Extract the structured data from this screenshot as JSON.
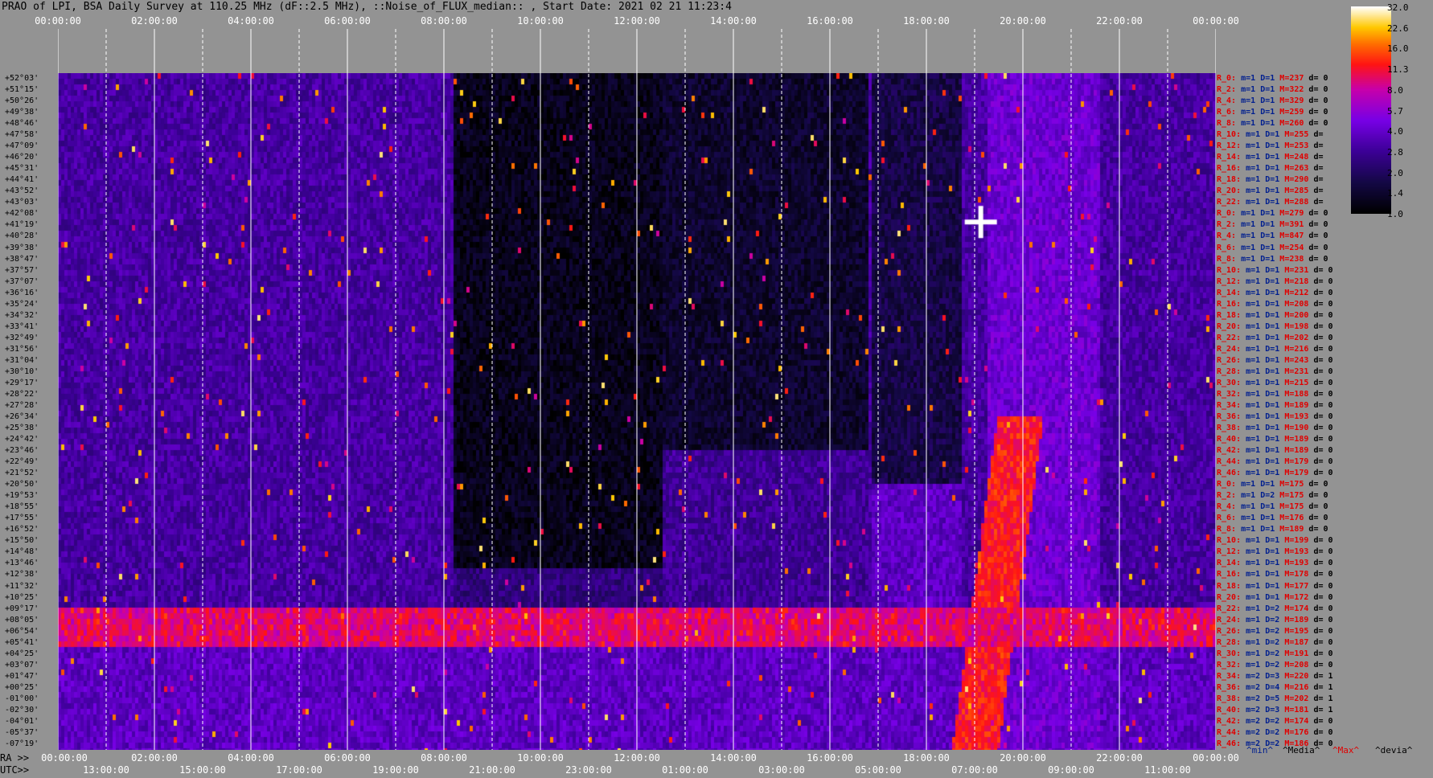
{
  "title": "PRAO of LPI, BSA Daily Survey at 110.25 MHz (dF::2.5 MHz), ::Noise_of_FLUX_median:: , Start Date: 2021 02 21 11:23:4",
  "chart_data": {
    "type": "heatmap",
    "title": "PRAO of LPI, BSA Daily Survey at 110.25 MHz (dF::2.5 MHz), ::Noise_of_FLUX_median:: , Start Date: 2021 02 21 11:23:4",
    "x_top_labels": [
      "00:00:00",
      "02:00:00",
      "04:00:00",
      "06:00:00",
      "08:00:00",
      "10:00:00",
      "12:00:00",
      "14:00:00",
      "16:00:00",
      "18:00:00",
      "20:00:00",
      "22:00:00",
      "00:00:00"
    ],
    "x_ra_labels": [
      "00:00:00",
      "02:00:00",
      "04:00:00",
      "06:00:00",
      "08:00:00",
      "10:00:00",
      "12:00:00",
      "14:00:00",
      "16:00:00",
      "18:00:00",
      "20:00:00",
      "22:00:00",
      "00:00:00"
    ],
    "x_utc_labels": [
      "13:00:00",
      "15:00:00",
      "17:00:00",
      "19:00:00",
      "21:00:00",
      "23:00:00",
      "01:00:00",
      "03:00:00",
      "05:00:00",
      "07:00:00",
      "09:00:00",
      "11:00:00"
    ],
    "ra_prefix": "RA >>",
    "utc_prefix": "UTC>>",
    "declinations": [
      "+52°03'",
      "+51°15'",
      "+50°26'",
      "+49°38'",
      "+48°46'",
      "+47°58'",
      "+47°09'",
      "+46°20'",
      "+45°31'",
      "+44°41'",
      "+43°52'",
      "+43°03'",
      "+42°08'",
      "+41°19'",
      "+40°28'",
      "+39°38'",
      "+38°47'",
      "+37°57'",
      "+37°07'",
      "+36°16'",
      "+35°24'",
      "+34°32'",
      "+33°41'",
      "+32°49'",
      "+31°56'",
      "+31°04'",
      "+30°10'",
      "+29°17'",
      "+28°22'",
      "+27°28'",
      "+26°34'",
      "+25°38'",
      "+24°42'",
      "+23°46'",
      "+22°49'",
      "+21°52'",
      "+20°50'",
      "+19°53'",
      "+18°55'",
      "+17°55'",
      "+16°52'",
      "+15°50'",
      "+14°48'",
      "+13°46'",
      "+12°38'",
      "+11°32'",
      "+10°25'",
      "+09°17'",
      "+08°05'",
      "+06°54'",
      "+05°41'",
      "+04°25'",
      "+03°07'",
      "+01°47'",
      "+00°25'",
      "-01°00'",
      "-02°30'",
      "-04°01'",
      "-05°37'",
      "-07°19'"
    ],
    "row_labels": [
      [
        "R_0:",
        "m=1",
        "D=1",
        "M=237",
        "d= 0"
      ],
      [
        "R_2:",
        "m=1",
        "D=1",
        "M=322",
        "d= 0"
      ],
      [
        "R_4:",
        "m=1",
        "D=1",
        "M=329",
        "d= 0"
      ],
      [
        "R_6:",
        "m=1",
        "D=1",
        "M=259",
        "d= 0"
      ],
      [
        "R_8:",
        "m=1",
        "D=1",
        "M=260",
        "d= 0"
      ],
      [
        "R_10:",
        "m=1",
        "D=1",
        "M=255",
        "d="
      ],
      [
        "R_12:",
        "m=1",
        "D=1",
        "M=253",
        "d="
      ],
      [
        "R_14:",
        "m=1",
        "D=1",
        "M=248",
        "d="
      ],
      [
        "R_16:",
        "m=1",
        "D=1",
        "M=263",
        "d="
      ],
      [
        "R_18:",
        "m=1",
        "D=1",
        "M=290",
        "d="
      ],
      [
        "R_20:",
        "m=1",
        "D=1",
        "M=285",
        "d="
      ],
      [
        "R_22:",
        "m=1",
        "D=1",
        "M=288",
        "d="
      ],
      [
        "R_0:",
        "m=1",
        "D=1",
        "M=279",
        "d= 0"
      ],
      [
        "R_2:",
        "m=1",
        "D=1",
        "M=391",
        "d= 0"
      ],
      [
        "R_4:",
        "m=1",
        "D=1",
        "M=847",
        "d= 0"
      ],
      [
        "R_6:",
        "m=1",
        "D=1",
        "M=254",
        "d= 0"
      ],
      [
        "R_8:",
        "m=1",
        "D=1",
        "M=238",
        "d= 0"
      ],
      [
        "R_10:",
        "m=1",
        "D=1",
        "M=231",
        "d= 0"
      ],
      [
        "R_12:",
        "m=1",
        "D=1",
        "M=218",
        "d= 0"
      ],
      [
        "R_14:",
        "m=1",
        "D=1",
        "M=212",
        "d= 0"
      ],
      [
        "R_16:",
        "m=1",
        "D=1",
        "M=208",
        "d= 0"
      ],
      [
        "R_18:",
        "m=1",
        "D=1",
        "M=200",
        "d= 0"
      ],
      [
        "R_20:",
        "m=1",
        "D=1",
        "M=198",
        "d= 0"
      ],
      [
        "R_22:",
        "m=1",
        "D=1",
        "M=202",
        "d= 0"
      ],
      [
        "R_24:",
        "m=1",
        "D=1",
        "M=216",
        "d= 0"
      ],
      [
        "R_26:",
        "m=1",
        "D=1",
        "M=243",
        "d= 0"
      ],
      [
        "R_28:",
        "m=1",
        "D=1",
        "M=231",
        "d= 0"
      ],
      [
        "R_30:",
        "m=1",
        "D=1",
        "M=215",
        "d= 0"
      ],
      [
        "R_32:",
        "m=1",
        "D=1",
        "M=188",
        "d= 0"
      ],
      [
        "R_34:",
        "m=1",
        "D=1",
        "M=189",
        "d= 0"
      ],
      [
        "R_36:",
        "m=1",
        "D=1",
        "M=193",
        "d= 0"
      ],
      [
        "R_38:",
        "m=1",
        "D=1",
        "M=190",
        "d= 0"
      ],
      [
        "R_40:",
        "m=1",
        "D=1",
        "M=189",
        "d= 0"
      ],
      [
        "R_42:",
        "m=1",
        "D=1",
        "M=189",
        "d= 0"
      ],
      [
        "R_44:",
        "m=1",
        "D=1",
        "M=179",
        "d= 0"
      ],
      [
        "R_46:",
        "m=1",
        "D=1",
        "M=179",
        "d= 0"
      ],
      [
        "R_0:",
        "m=1",
        "D=1",
        "M=175",
        "d= 0"
      ],
      [
        "R_2:",
        "m=1",
        "D=2",
        "M=175",
        "d= 0"
      ],
      [
        "R_4:",
        "m=1",
        "D=1",
        "M=175",
        "d= 0"
      ],
      [
        "R_6:",
        "m=1",
        "D=1",
        "M=176",
        "d= 0"
      ],
      [
        "R_8:",
        "m=1",
        "D=1",
        "M=189",
        "d= 0"
      ],
      [
        "R_10:",
        "m=1",
        "D=1",
        "M=199",
        "d= 0"
      ],
      [
        "R_12:",
        "m=1",
        "D=1",
        "M=193",
        "d= 0"
      ],
      [
        "R_14:",
        "m=1",
        "D=1",
        "M=193",
        "d= 0"
      ],
      [
        "R_16:",
        "m=1",
        "D=1",
        "M=178",
        "d= 0"
      ],
      [
        "R_18:",
        "m=1",
        "D=1",
        "M=177",
        "d= 0"
      ],
      [
        "R_20:",
        "m=1",
        "D=1",
        "M=172",
        "d= 0"
      ],
      [
        "R_22:",
        "m=1",
        "D=2",
        "M=174",
        "d= 0"
      ],
      [
        "R_24:",
        "m=1",
        "D=2",
        "M=189",
        "d= 0"
      ],
      [
        "R_26:",
        "m=1",
        "D=2",
        "M=195",
        "d= 0"
      ],
      [
        "R_28:",
        "m=1",
        "D=2",
        "M=187",
        "d= 0"
      ],
      [
        "R_30:",
        "m=1",
        "D=2",
        "M=191",
        "d= 0"
      ],
      [
        "R_32:",
        "m=1",
        "D=2",
        "M=208",
        "d= 0"
      ],
      [
        "R_34:",
        "m=2",
        "D=3",
        "M=220",
        "d= 1"
      ],
      [
        "R_36:",
        "m=2",
        "D=4",
        "M=216",
        "d= 1"
      ],
      [
        "R_38:",
        "m=2",
        "D=5",
        "M=202",
        "d= 1"
      ],
      [
        "R_40:",
        "m=2",
        "D=3",
        "M=181",
        "d= 1"
      ],
      [
        "R_42:",
        "m=2",
        "D=2",
        "M=174",
        "d= 0"
      ],
      [
        "R_44:",
        "m=2",
        "D=2",
        "M=176",
        "d= 0"
      ],
      [
        "R_46:",
        "m=2",
        "D=2",
        "M=186",
        "d= 0"
      ]
    ],
    "colorbar_ticks": [
      "32.0",
      "22.6",
      "16.0",
      "11.3",
      "8.0",
      "5.7",
      "4.0",
      "2.8",
      "2.0",
      "1.4",
      "1.0"
    ],
    "legend_footer": [
      "^min^",
      "^Media^",
      "^Max^",
      "^devia^"
    ],
    "colors": {
      "bg": "#939393",
      "low": "#000000",
      "mid": "#6a00d8",
      "high": "#ff2000",
      "top": "#ffffff"
    }
  }
}
